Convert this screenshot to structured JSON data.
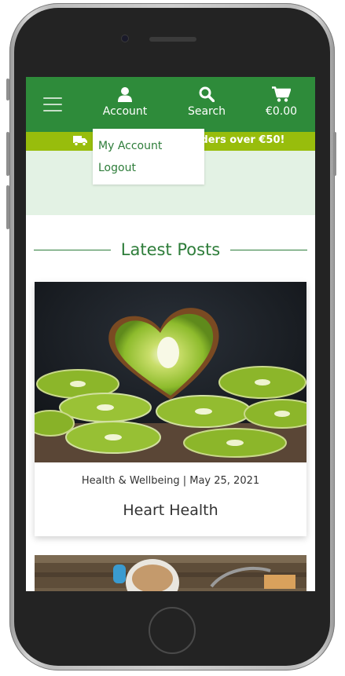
{
  "nav": {
    "account_label": "Account",
    "search_label": "Search",
    "cart_total": "€0.00"
  },
  "promo": {
    "text": "Free delivery on orders over €50!"
  },
  "account_menu": {
    "items": [
      "My Account",
      "Logout"
    ]
  },
  "section": {
    "title": "Latest Posts"
  },
  "posts": [
    {
      "meta": "Health & Wellbeing | May 25, 2021",
      "title": "Heart Health",
      "image_icon": "kiwi-image"
    },
    {
      "image_icon": "coffee-table-image"
    }
  ],
  "colors": {
    "nav_green": "#2e8b3a",
    "promo_green": "#98bd0c",
    "light_green": "#e3f2e4",
    "accent_text": "#2e7d3a"
  }
}
